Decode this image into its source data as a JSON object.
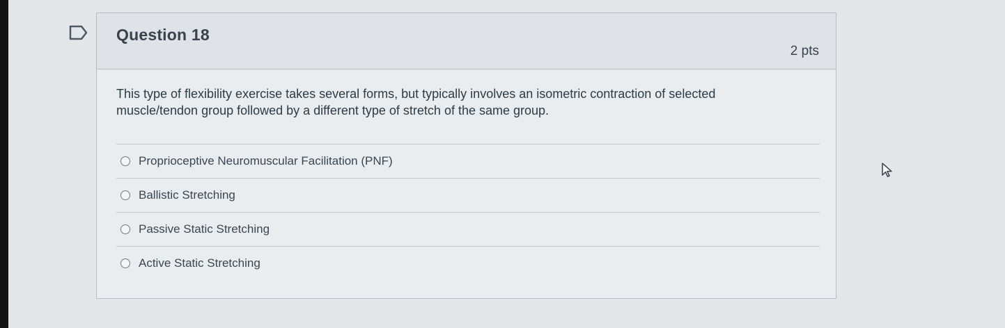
{
  "question": {
    "title": "Question 18",
    "points": "2 pts",
    "text": "This type of flexibility exercise takes several forms, but typically involves an isometric contraction of selected muscle/tendon group followed by a different type of stretch of the same group.",
    "flag_icon": "flag-outline-icon",
    "answers": [
      {
        "label": "Proprioceptive Neuromuscular Facilitation (PNF)",
        "selected": false
      },
      {
        "label": "Ballistic Stretching",
        "selected": false
      },
      {
        "label": "Passive Static Stretching",
        "selected": false
      },
      {
        "label": "Active Static Stretching",
        "selected": false
      }
    ]
  },
  "cursor": {
    "icon": "mouse-pointer-icon"
  },
  "colors": {
    "background": "#e4e7ea",
    "header": "#dfe3e7",
    "border": "#b6bcc2",
    "text": "#2d3b45"
  }
}
